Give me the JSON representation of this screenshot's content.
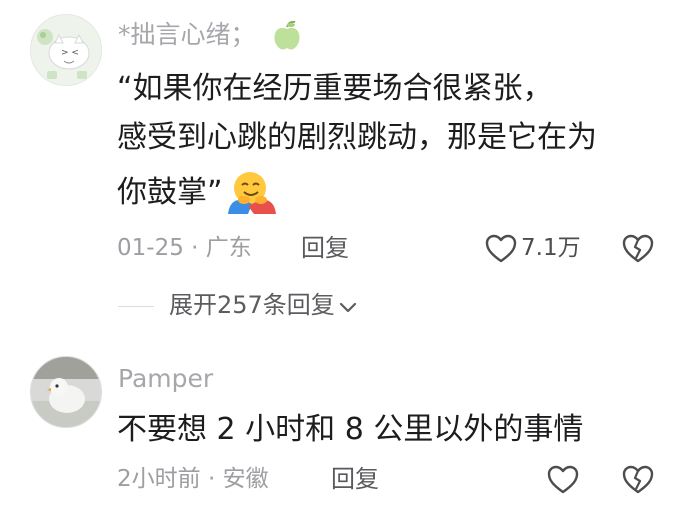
{
  "comments": [
    {
      "username": "*拙言心绪；",
      "text_lines": [
        "“如果你在经历重要场合很紧张，",
        "感受到心跳的剧烈跳动，那是它在为",
        "你鼓掌”"
      ],
      "meta": "01-25 · 广东",
      "reply_label": "回复",
      "like_count": "7.1万",
      "expand_label": "展开257条回复"
    },
    {
      "username": "Pamper",
      "text": "不要想 2 小时和 8 公里以外的事情",
      "meta": "2小时前 · 安徽",
      "reply_label": "回复",
      "like_count": ""
    }
  ],
  "icons": {
    "username_badge": "apple-icon",
    "emoji": "hugging-face-icon",
    "like": "heart-outline-icon",
    "dislike": "broken-heart-icon",
    "expand": "chevron-down-icon"
  },
  "colors": {
    "username": "#a7a7ab",
    "text": "#1d1d1f",
    "meta": "#9d9da2"
  }
}
